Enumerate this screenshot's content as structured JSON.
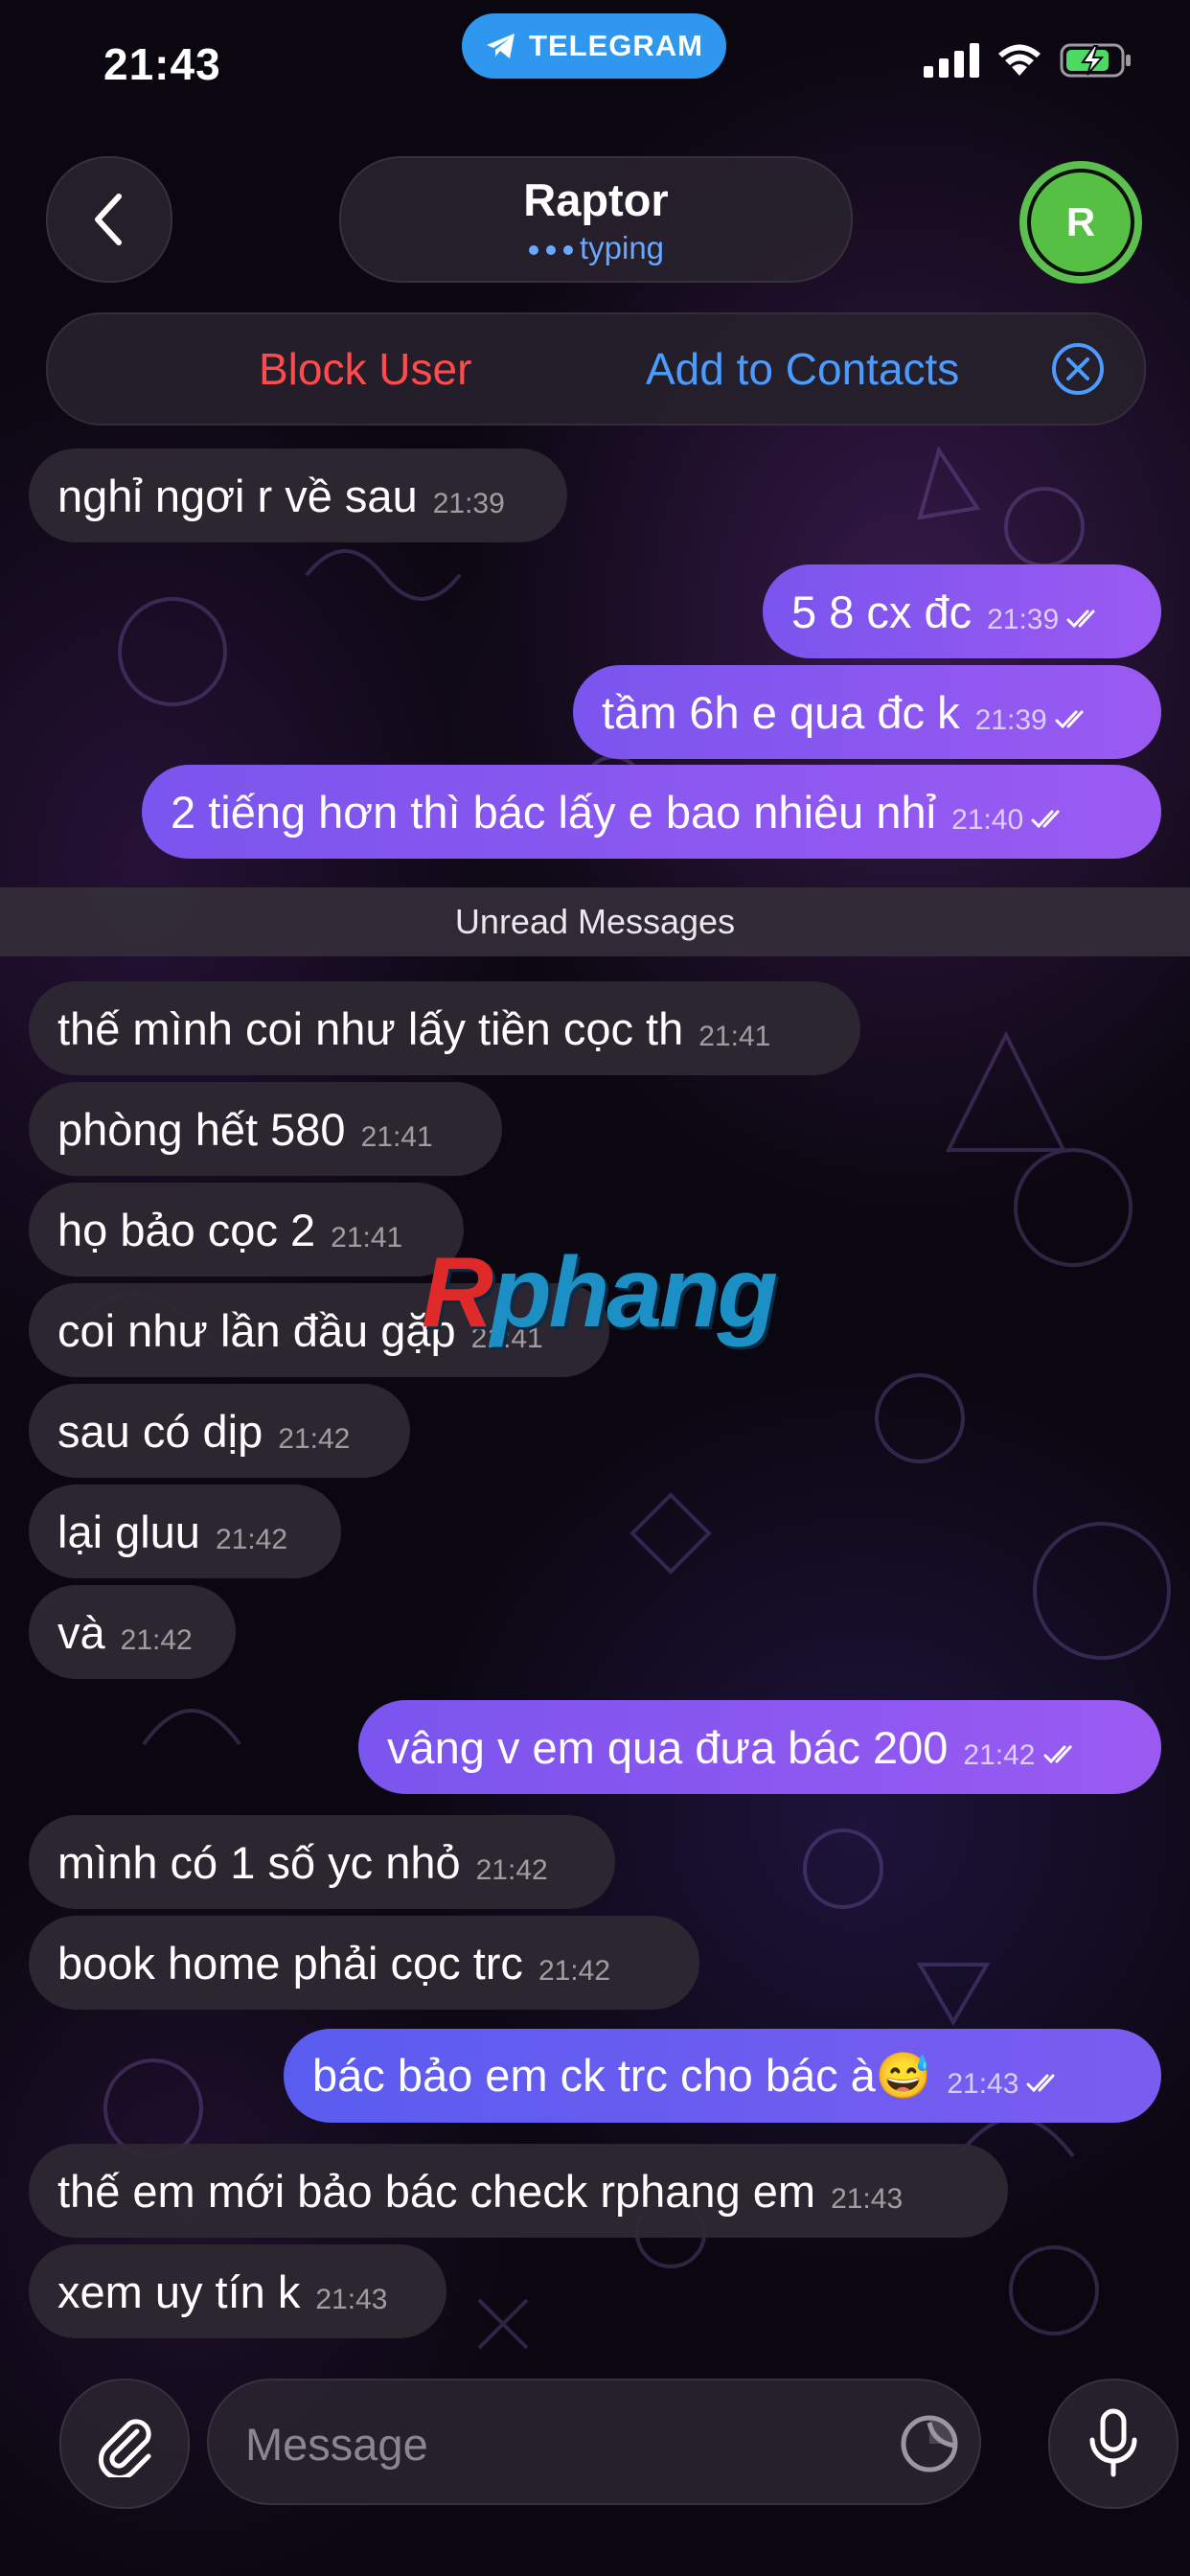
{
  "status_bar": {
    "time": "21:43",
    "pill_label": "TELEGRAM",
    "icons": [
      "cellular-signal-icon",
      "wifi-icon",
      "battery-charging-icon"
    ]
  },
  "header": {
    "contact_name": "Raptor",
    "status_text": "typing",
    "avatar_initial": "R",
    "avatar_color": "#55c044"
  },
  "action_bar": {
    "block_label": "Block User",
    "add_label": "Add to Contacts"
  },
  "messages": [
    {
      "dir": "in",
      "text": "nghỉ ngơi r về sau",
      "time": "21:39"
    },
    {
      "dir": "out",
      "text": "5 8 cx đc",
      "time": "21:39"
    },
    {
      "dir": "out",
      "text": "tầm 6h e qua đc k",
      "time": "21:39"
    },
    {
      "dir": "out",
      "text": "2 tiếng hơn thì bác lấy e bao nhiêu nhỉ",
      "time": "21:40"
    },
    {
      "dir": "in",
      "text": "thế mình coi như lấy tiền cọc th",
      "time": "21:41"
    },
    {
      "dir": "in",
      "text": "phòng hết 580",
      "time": "21:41"
    },
    {
      "dir": "in",
      "text": "họ bảo cọc 2",
      "time": "21:41"
    },
    {
      "dir": "in",
      "text": "coi như lần đầu gặp",
      "time": "21:41"
    },
    {
      "dir": "in",
      "text": "sau có dịp",
      "time": "21:42"
    },
    {
      "dir": "in",
      "text": "lại gluu",
      "time": "21:42"
    },
    {
      "dir": "in",
      "text": "và",
      "time": "21:42"
    },
    {
      "dir": "out",
      "text": "vâng v em qua đưa bác 200",
      "time": "21:42"
    },
    {
      "dir": "in",
      "text": "mình có 1 số yc nhỏ",
      "time": "21:42"
    },
    {
      "dir": "in",
      "text": "book home phải cọc trc",
      "time": "21:42"
    },
    {
      "dir": "out",
      "text": "bác bảo em ck trc cho bác à😅",
      "time": "21:43"
    },
    {
      "dir": "in",
      "text": "thế em mới bảo bác check rphang em",
      "time": "21:43"
    },
    {
      "dir": "in",
      "text": "xem uy tín k",
      "time": "21:43"
    }
  ],
  "unread_divider": "Unread Messages",
  "watermark": {
    "first": "R",
    "rest": "phang"
  },
  "input": {
    "placeholder": "Message"
  },
  "colors": {
    "outgoing_bubble": "#8a58f0",
    "incoming_bubble": "#2e2832",
    "block": "#ff4b4b",
    "accent": "#4c9cff"
  }
}
